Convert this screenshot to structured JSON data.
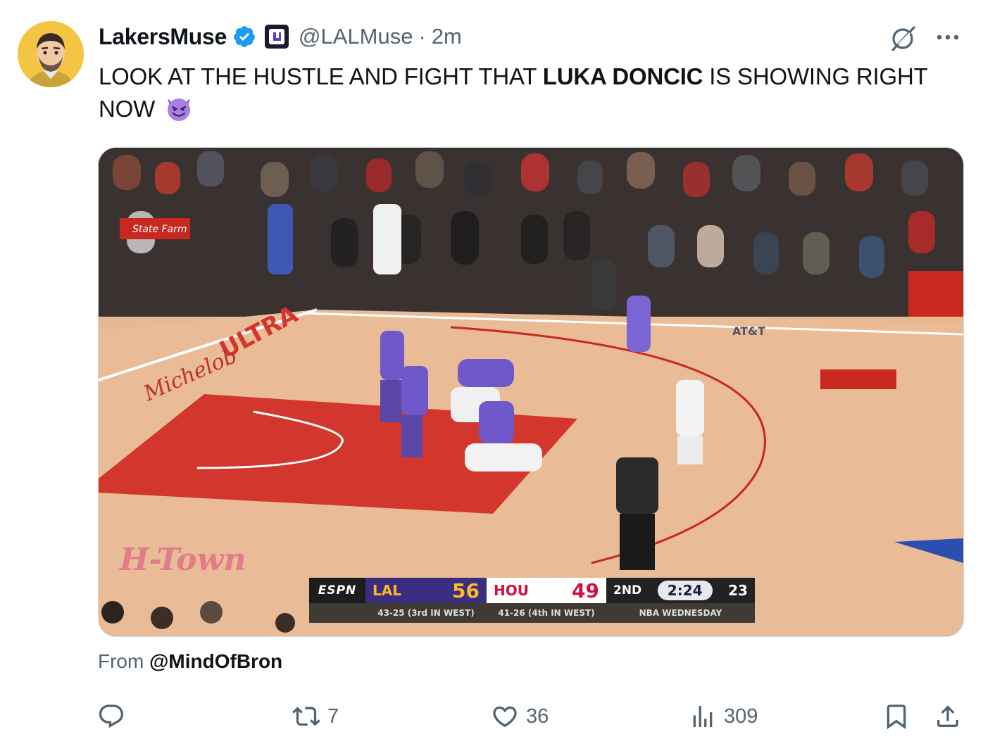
{
  "author": {
    "display_name": "LakersMuse",
    "handle": "@LALMuse",
    "time": "2m",
    "verified": true,
    "avatar_icon": "cartoon-man-avatar",
    "affiliate_badge_icon": "purple-logo-badge"
  },
  "tweet": {
    "text_part1": "LOOK AT THE HUSTLE AND FIGHT THAT ",
    "text_bold": "LUKA DONCIC",
    "text_part2": " IS SHOWING RIGHT NOW",
    "emoji": "smiling-face-with-horns-emoji"
  },
  "media": {
    "description_icon": "basketball-game-video-frame",
    "scorebug": {
      "network": "ESPN",
      "team1_abbr": "LAL",
      "team1_score": "56",
      "team1_record": "43-25 (3rd IN WEST)",
      "team2_abbr": "HOU",
      "team2_score": "49",
      "team2_record": "41-26 (4th IN WEST)",
      "quarter": "2ND",
      "clock": "2:24",
      "shot_clock": "23",
      "broadcast": "NBA WEDNESDAY"
    },
    "court_text": {
      "sponsor1": "State Farm",
      "sponsor2": "AT&T",
      "sponsor3": "ULTRA",
      "sponsor4": "Michelob",
      "floor_logo": "H-Town"
    }
  },
  "source": {
    "prefix": "From ",
    "handle": "@MindOfBron"
  },
  "actions": {
    "reply_count": "",
    "retweet_count": "7",
    "like_count": "36",
    "views_count": "309"
  },
  "colors": {
    "text_primary": "#0f1419",
    "text_secondary": "#536471",
    "verified_blue": "#1d9bf0",
    "lakers_purple": "#552583",
    "lakers_gold": "#fdb927",
    "rockets_red": "#ce1141"
  }
}
